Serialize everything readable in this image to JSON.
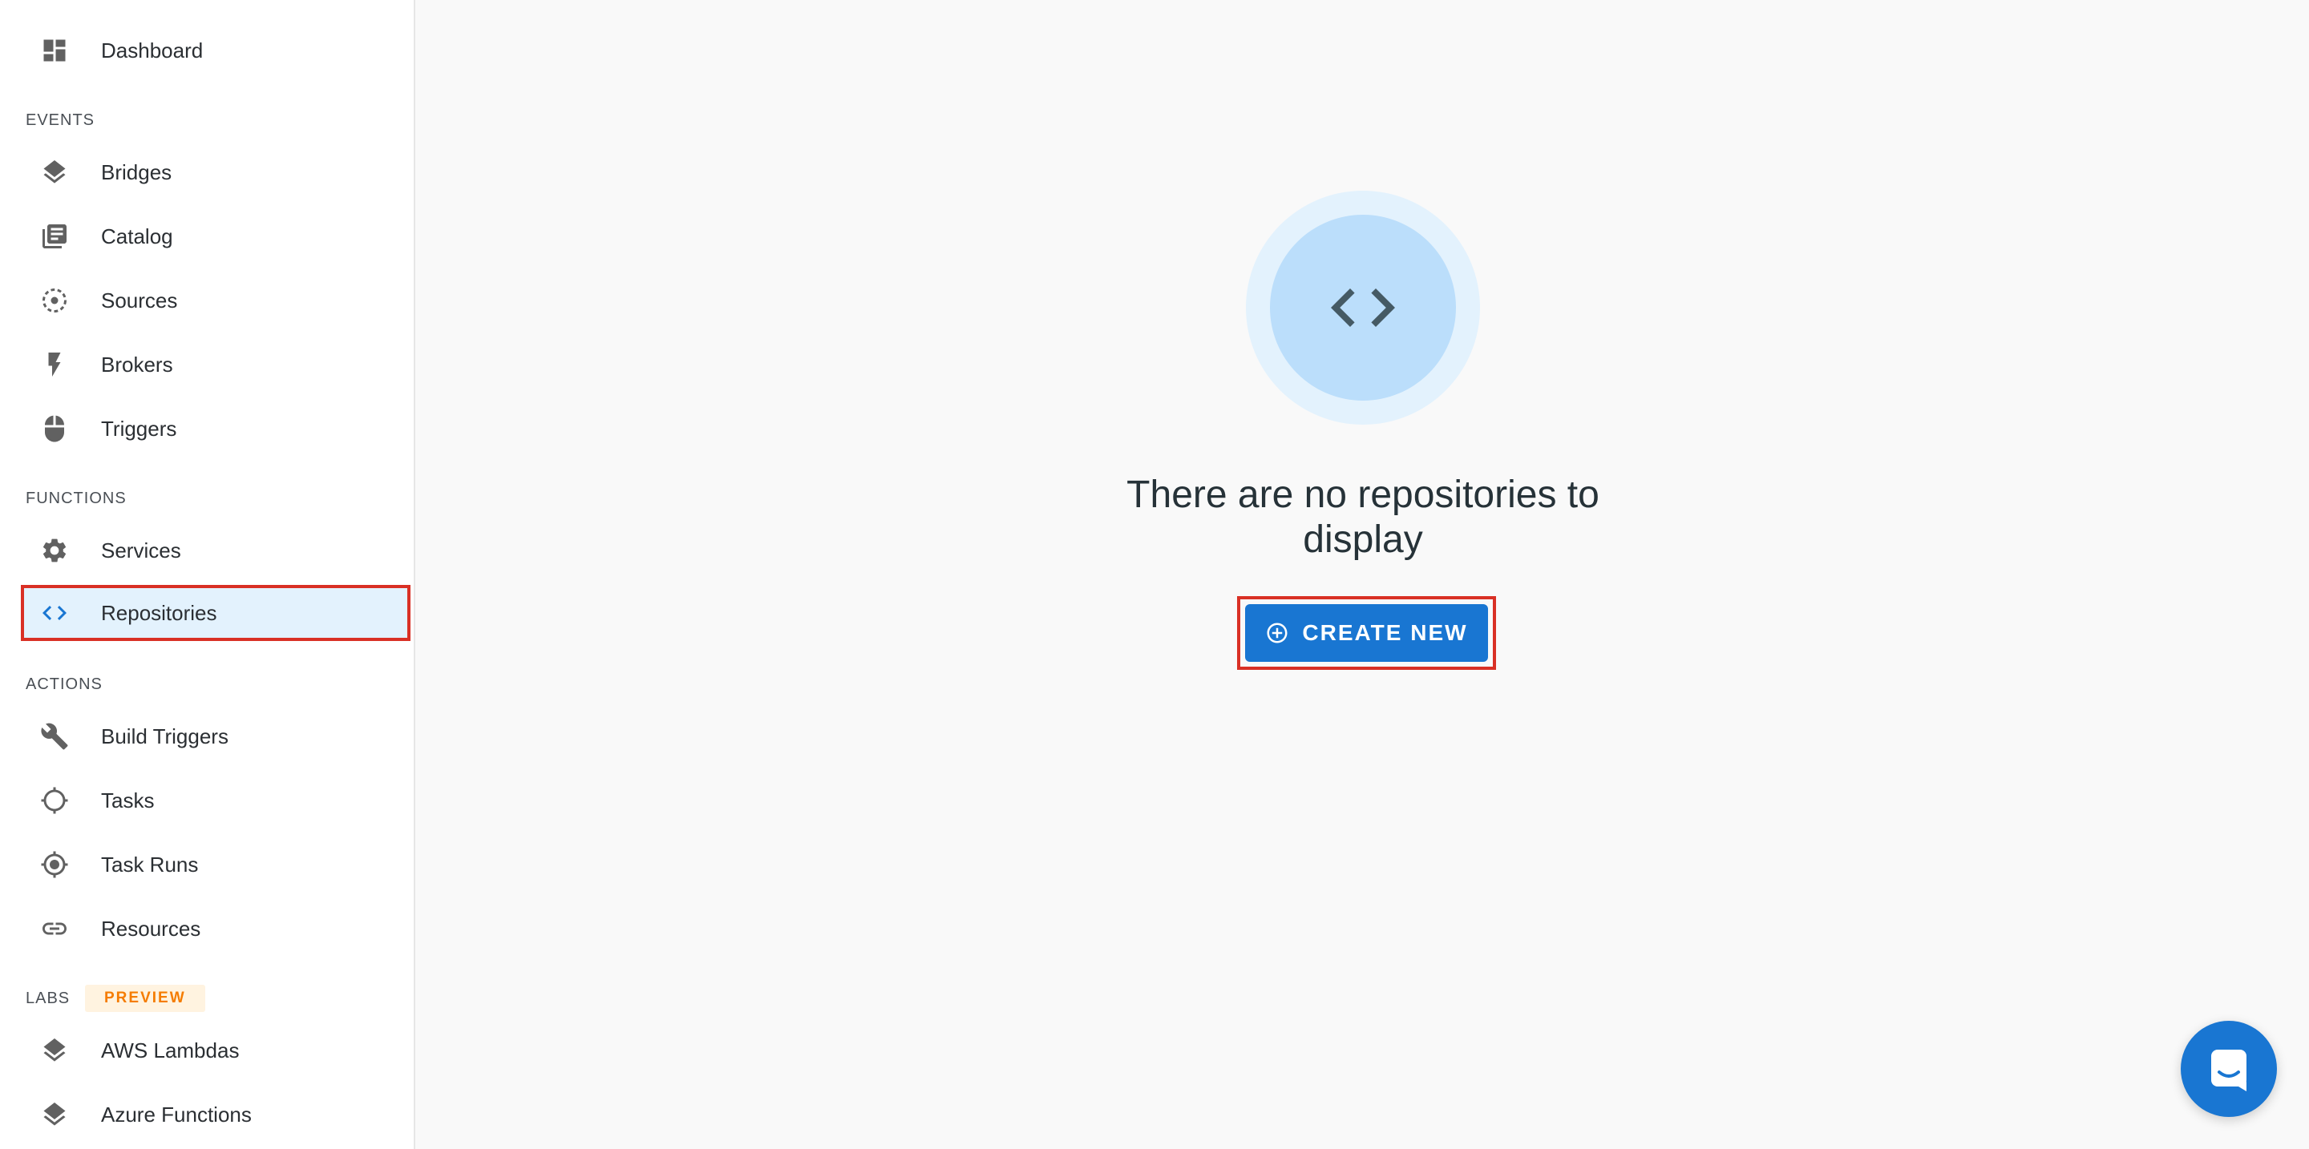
{
  "sidebar": {
    "dashboard": {
      "label": "Dashboard",
      "icon": "dashboard-icon"
    },
    "sections": {
      "events": "EVENTS",
      "functions": "FUNCTIONS",
      "actions": "ACTIONS",
      "labs": "LABS"
    },
    "preview_badge": "PREVIEW",
    "events_items": [
      {
        "label": "Bridges",
        "icon": "layers-icon"
      },
      {
        "label": "Catalog",
        "icon": "library-books-icon"
      },
      {
        "label": "Sources",
        "icon": "dashed-circle-dot-icon"
      },
      {
        "label": "Brokers",
        "icon": "lightning-bolt-icon"
      },
      {
        "label": "Triggers",
        "icon": "mouse-icon"
      }
    ],
    "functions_items": [
      {
        "label": "Services",
        "icon": "gear-icon"
      },
      {
        "label": "Repositories",
        "icon": "code-icon",
        "active": true
      }
    ],
    "actions_items": [
      {
        "label": "Build Triggers",
        "icon": "wrench-icon"
      },
      {
        "label": "Tasks",
        "icon": "crosshair-icon"
      },
      {
        "label": "Task Runs",
        "icon": "target-icon"
      },
      {
        "label": "Resources",
        "icon": "link-icon"
      }
    ],
    "labs_items": [
      {
        "label": "AWS Lambdas",
        "icon": "layers-icon"
      },
      {
        "label": "Azure Functions",
        "icon": "layers-icon"
      }
    ]
  },
  "main": {
    "empty_state": {
      "icon": "code-icon",
      "title_line1": "There are no repositories to",
      "title_line2": "display",
      "create_button_label": "CREATE NEW",
      "create_button_icon": "add-circle-outline-icon"
    }
  },
  "chat": {
    "icon": "chat-icon"
  },
  "colors": {
    "accent": "#1976d2",
    "active_bg": "#e3f2fd",
    "highlight_border": "#d93025",
    "preview_text": "#f57c00"
  }
}
